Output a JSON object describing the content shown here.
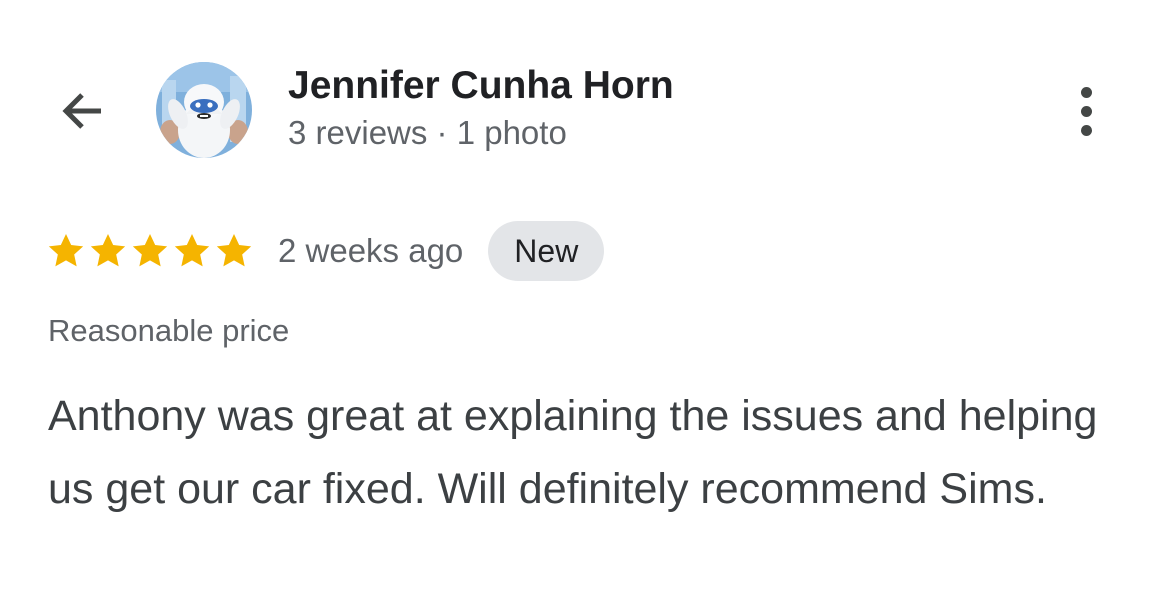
{
  "reviewer": {
    "name": "Jennifer Cunha Horn",
    "meta": "3 reviews · 1 photo",
    "avatar_icon": "yeti-avatar"
  },
  "header": {
    "back_icon": "arrow-left-icon",
    "more_icon": "more-vertical-icon"
  },
  "review": {
    "rating": 5,
    "max_rating": 5,
    "star_color": "#F5B400",
    "time": "2 weeks ago",
    "badge": "New",
    "tag": "Reasonable price",
    "text": "Anthony was great at explaining the issues and helping us get our car fixed. Will definitely recommend Sims."
  }
}
